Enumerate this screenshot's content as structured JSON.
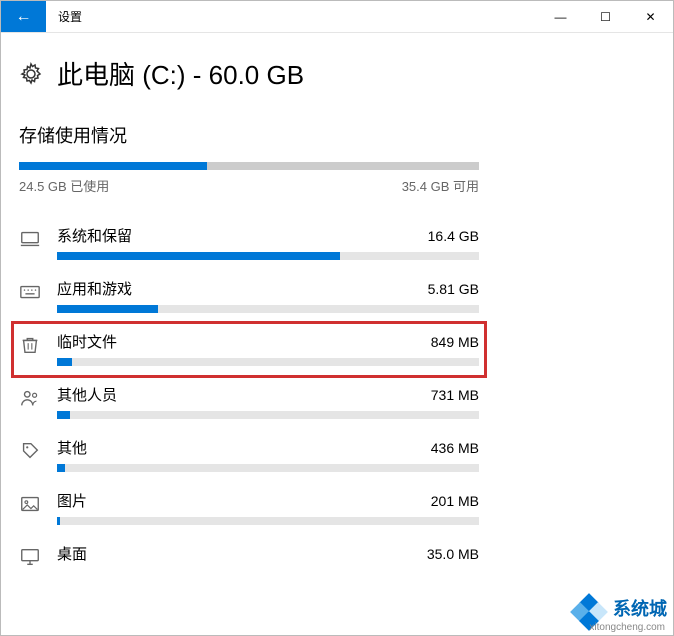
{
  "window": {
    "title": "设置",
    "back_glyph": "←",
    "min_glyph": "―",
    "max_glyph": "☐",
    "close_glyph": "✕"
  },
  "header": {
    "gear_glyph": "⚙",
    "page_title": "此电脑 (C:) - 60.0 GB"
  },
  "storage": {
    "section_title": "存储使用情况",
    "used_pct": 40.8,
    "used_label": "24.5 GB 已使用",
    "free_label": "35.4 GB 可用"
  },
  "categories": [
    {
      "label": "系统和保留",
      "size": "16.4 GB",
      "pct": 67,
      "icon": "computer"
    },
    {
      "label": "应用和游戏",
      "size": "5.81 GB",
      "pct": 24,
      "icon": "keyboard"
    },
    {
      "label": "临时文件",
      "size": "849 MB",
      "pct": 3.5,
      "icon": "trash",
      "hl": true
    },
    {
      "label": "其他人员",
      "size": "731 MB",
      "pct": 3,
      "icon": "people"
    },
    {
      "label": "其他",
      "size": "436 MB",
      "pct": 1.8,
      "icon": "tag"
    },
    {
      "label": "图片",
      "size": "201 MB",
      "pct": 0.8,
      "icon": "image"
    },
    {
      "label": "桌面",
      "size": "35.0 MB",
      "pct": 0.2,
      "icon": "desktop"
    }
  ],
  "watermark": {
    "brand": "系统城",
    "url": "xitongcheng.com"
  },
  "icons": {
    "computer": "<rect x='3' y='5' width='18' height='11' rx='1' fill='none' stroke='currentColor' stroke-width='1.5'/><line x1='2' y1='19' x2='22' y2='19' stroke='currentColor' stroke-width='1.5'/>",
    "keyboard": "<rect x='2' y='6' width='20' height='12' rx='1' fill='none' stroke='currentColor' stroke-width='1.5'/><circle cx='6' cy='10' r='0.8' fill='currentColor'/><circle cx='10' cy='10' r='0.8' fill='currentColor'/><circle cx='14' cy='10' r='0.8' fill='currentColor'/><circle cx='18' cy='10' r='0.8' fill='currentColor'/><line x1='7' y1='14' x2='17' y2='14' stroke='currentColor' stroke-width='1.5'/>",
    "trash": "<path d='M5 7h14l-1.5 13h-11z' fill='none' stroke='currentColor' stroke-width='1.5'/><line x1='4' y1='7' x2='20' y2='7' stroke='currentColor' stroke-width='1.5'/><line x1='10' y1='10' x2='10' y2='17' stroke='currentColor' stroke-width='1.2'/><line x1='14' y1='10' x2='14' y2='17' stroke='currentColor' stroke-width='1.2'/><path d='M9 7V5h6v2' fill='none' stroke='currentColor' stroke-width='1.5'/>",
    "people": "<circle cx='9' cy='8' r='3' fill='none' stroke='currentColor' stroke-width='1.5'/><path d='M3 20c0-3.3 2.7-6 6-6s6 2.7 6 6' fill='none' stroke='currentColor' stroke-width='1.5'/><circle cx='17' cy='9' r='2.2' fill='none' stroke='currentColor' stroke-width='1.3'/><path d='M15 20c0-2.5 1.8-4.5 4-4.5' fill='none' stroke='currentColor' stroke-width='1.3'/>",
    "tag": "<path d='M5 4h8l7 7-8 8-7-7z' fill='none' stroke='currentColor' stroke-width='1.5'/><circle cx='9' cy='8' r='1.2' fill='currentColor'/>",
    "image": "<rect x='3' y='5' width='18' height='14' rx='1' fill='none' stroke='currentColor' stroke-width='1.5'/><circle cx='8' cy='10' r='1.5' fill='none' stroke='currentColor' stroke-width='1.3'/><path d='M4 18l5-5 4 4 3-3 4 4' fill='none' stroke='currentColor' stroke-width='1.3'/>",
    "desktop": "<rect x='3' y='4' width='18' height='12' rx='1' fill='none' stroke='currentColor' stroke-width='1.5'/><line x1='9' y1='20' x2='15' y2='20' stroke='currentColor' stroke-width='1.5'/><line x1='12' y1='16' x2='12' y2='20' stroke='currentColor' stroke-width='1.5'/>"
  }
}
